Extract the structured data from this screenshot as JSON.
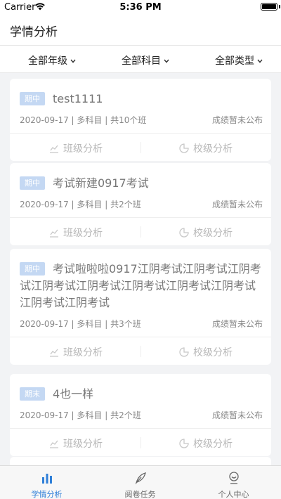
{
  "status": {
    "carrier": "Carrier",
    "time": "5:36 PM"
  },
  "nav": {
    "title": "学情分析"
  },
  "filters": [
    {
      "label": "全部年级"
    },
    {
      "label": "全部科目"
    },
    {
      "label": "全部类型"
    }
  ],
  "cards": [
    {
      "tag": "期中",
      "title": "test1111",
      "date_info": "2020-09-17 | 多科目 | 共10个班",
      "status": "成绩暂未公布",
      "class_action": "班级分析",
      "school_action": "校级分析"
    },
    {
      "tag": "期中",
      "title": "考试新建0917考试",
      "date_info": "2020-09-17 | 多科目 | 共2个班",
      "status": "成绩暂未公布",
      "class_action": "班级分析",
      "school_action": "校级分析"
    },
    {
      "tag": "期中",
      "title": "考试啦啦啦0917江阴考试江阴考试江阴考试江阴考试江阴考试江阴考试江阴考试江阴考试江阴考试江阴考试",
      "date_info": "2020-09-17 | 多科目 | 共3个班",
      "status": "成绩暂未公布",
      "class_action": "班级分析",
      "school_action": "校级分析"
    },
    {
      "tag": "期末",
      "title": "4也一样",
      "date_info": "2020-09-17 | 多科目 | 共2个班",
      "status": "成绩暂未公布",
      "class_action": "班级分析",
      "school_action": "校级分析"
    }
  ],
  "tabs": [
    {
      "label": "学情分析",
      "icon": "bar-chart-icon"
    },
    {
      "label": "阅卷任务",
      "icon": "feather-pen-icon"
    },
    {
      "label": "个人中心",
      "icon": "person-icon"
    }
  ],
  "colors": {
    "accent": "#2f7fd8",
    "tag_bg": "#c4d8f3",
    "muted_text": "#b8b8b8"
  }
}
